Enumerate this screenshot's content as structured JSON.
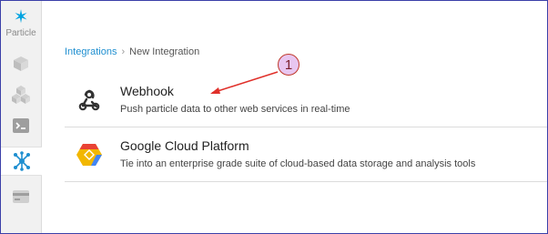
{
  "sidebar": {
    "brand": "Particle",
    "items": [
      {
        "icon": "cube-icon"
      },
      {
        "icon": "products-icon"
      },
      {
        "icon": "console-icon"
      },
      {
        "icon": "integrations-icon",
        "active": true
      },
      {
        "icon": "billing-card-icon"
      }
    ]
  },
  "breadcrumb": {
    "root": "Integrations",
    "separator": "›",
    "current": "New Integration"
  },
  "integrations": [
    {
      "title": "Webhook",
      "description": "Push particle data to other web services in real-time",
      "icon": "webhook-icon"
    },
    {
      "title": "Google Cloud Platform",
      "description": "Tie into an enterprise grade suite of cloud-based data storage and analysis tools",
      "icon": "google-cloud-icon"
    }
  ],
  "annotation": {
    "number": "1",
    "color": "#e0302a"
  }
}
